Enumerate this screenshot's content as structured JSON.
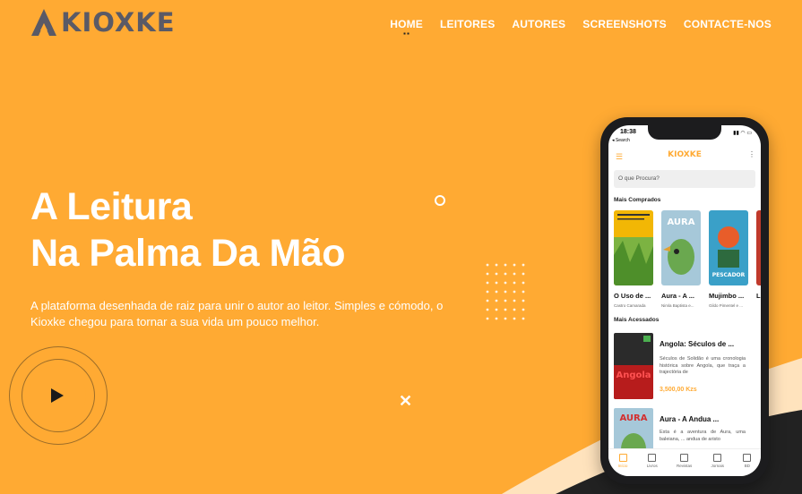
{
  "brand": {
    "name": "KIOXKE",
    "color": "#FFAA33",
    "dark": "#5a5a66"
  },
  "nav": {
    "items": [
      {
        "label": "HOME",
        "active": true
      },
      {
        "label": "LEITORES"
      },
      {
        "label": "AUTORES"
      },
      {
        "label": "SCREENSHOTS"
      },
      {
        "label": "CONTACTE-NOS"
      }
    ]
  },
  "hero": {
    "title_line1": "A Leitura",
    "title_line2": "Na Palma Da Mão",
    "description": "A plataforma desenhada de raiz para unir o autor ao leitor. Simples e cómodo, o Kioxke chegou para tornar a sua vida um pouco melhor."
  },
  "phone": {
    "status_time": "18:38",
    "status_back": "◂ Search",
    "app_logo": "KIOXKE",
    "search_placeholder": "O que Procura?",
    "section_top": "Mais Comprados",
    "section_access": "Mais Acessados",
    "top_books": [
      {
        "title": "O Uso de ...",
        "author": "Castro Camarada",
        "cover": "#f2b705"
      },
      {
        "title": "Aura - A ...",
        "author": "Nimla Baptista e...",
        "cover": "#a6c8d9"
      },
      {
        "title": "Mujimbo ...",
        "author": "Gildo Pimentel e ...",
        "cover": "#3aa0c8"
      },
      {
        "title": "Lu",
        "author": "",
        "cover": "#c0392b"
      }
    ],
    "accessed": [
      {
        "title": "Angola: Séculos de ...",
        "description": "Séculos de Solidão é uma cronologia histórica sobre Angola, que traça a trajectória de",
        "price": "3,500,00 Kzs",
        "cover": "#b71c1c"
      },
      {
        "title": "Aura - A Andua ...",
        "description": "Esta é a aventura de Aura, uma baleiana, ... andua de aristo",
        "price": "",
        "cover": "#6aa84f"
      }
    ],
    "tabs": [
      {
        "label": "Início",
        "active": true
      },
      {
        "label": "Livros"
      },
      {
        "label": "Revistas"
      },
      {
        "label": "Jornais"
      },
      {
        "label": "BD"
      }
    ]
  }
}
